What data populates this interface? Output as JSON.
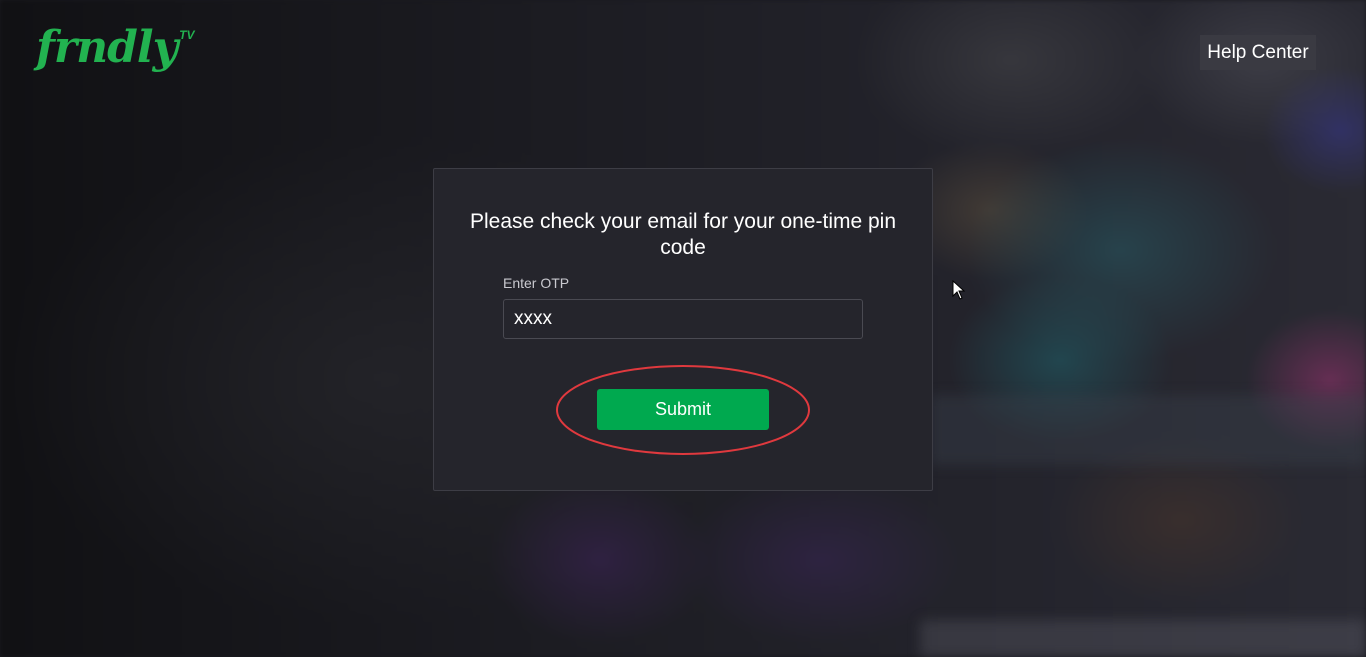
{
  "brand": {
    "logo_text": "frndly",
    "logo_superscript": "TV",
    "color": "#22b250"
  },
  "header": {
    "help_center_label": "Help Center"
  },
  "otp_dialog": {
    "title": "Please check your email for your one-time pin code",
    "otp_label": "Enter OTP",
    "otp_value": "xxxx",
    "submit_label": "Submit",
    "submit_color": "#00a94f"
  },
  "annotation": {
    "highlight_color": "#e0393e",
    "highlight_target": "submit-button"
  }
}
